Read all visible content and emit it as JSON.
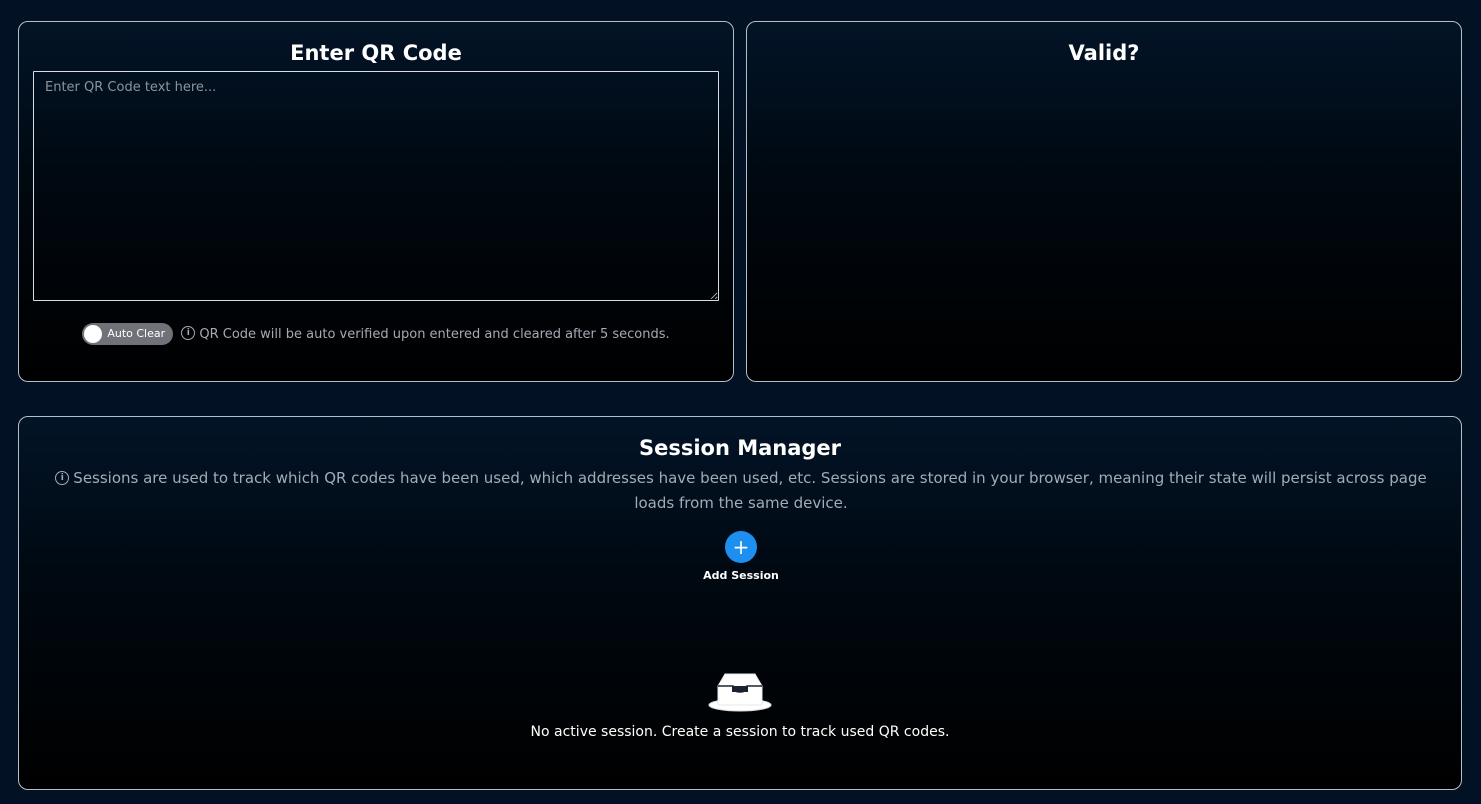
{
  "qr_panel": {
    "title": "Enter QR Code",
    "input_placeholder": "Enter QR Code text here...",
    "input_value": "",
    "auto_clear_label": "Auto Clear",
    "auto_clear_info": "QR Code will be auto verified upon entered and cleared after 5 seconds."
  },
  "valid_panel": {
    "title": "Valid?"
  },
  "session_manager": {
    "title": "Session Manager",
    "info": "Sessions are used to track which QR codes have been used, which addresses have been used, etc. Sessions are stored in your browser, meaning their state will persist across page loads from the same device.",
    "add_button_icon": "+",
    "add_label": "Add Session",
    "empty_icon": "inbox-icon",
    "empty_text": "No active session. Create a session to track used QR codes."
  },
  "colors": {
    "background": "#021224",
    "accent": "#1d8ff0",
    "border": "#b7bdc6",
    "muted_text": "#a4abb5"
  }
}
